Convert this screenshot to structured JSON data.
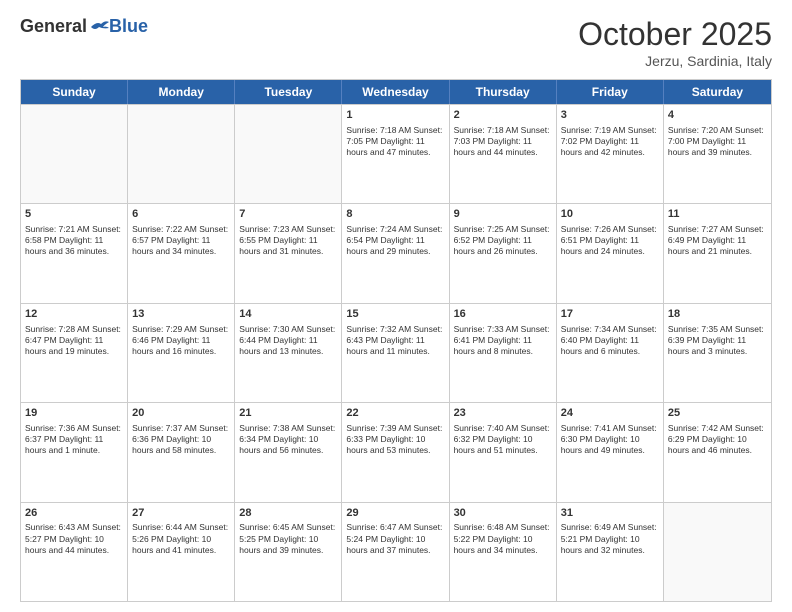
{
  "logo": {
    "general": "General",
    "blue": "Blue"
  },
  "title": "October 2025",
  "location": "Jerzu, Sardinia, Italy",
  "days_of_week": [
    "Sunday",
    "Monday",
    "Tuesday",
    "Wednesday",
    "Thursday",
    "Friday",
    "Saturday"
  ],
  "weeks": [
    [
      {
        "day": "",
        "info": ""
      },
      {
        "day": "",
        "info": ""
      },
      {
        "day": "",
        "info": ""
      },
      {
        "day": "1",
        "info": "Sunrise: 7:18 AM\nSunset: 7:05 PM\nDaylight: 11 hours and 47 minutes."
      },
      {
        "day": "2",
        "info": "Sunrise: 7:18 AM\nSunset: 7:03 PM\nDaylight: 11 hours and 44 minutes."
      },
      {
        "day": "3",
        "info": "Sunrise: 7:19 AM\nSunset: 7:02 PM\nDaylight: 11 hours and 42 minutes."
      },
      {
        "day": "4",
        "info": "Sunrise: 7:20 AM\nSunset: 7:00 PM\nDaylight: 11 hours and 39 minutes."
      }
    ],
    [
      {
        "day": "5",
        "info": "Sunrise: 7:21 AM\nSunset: 6:58 PM\nDaylight: 11 hours and 36 minutes."
      },
      {
        "day": "6",
        "info": "Sunrise: 7:22 AM\nSunset: 6:57 PM\nDaylight: 11 hours and 34 minutes."
      },
      {
        "day": "7",
        "info": "Sunrise: 7:23 AM\nSunset: 6:55 PM\nDaylight: 11 hours and 31 minutes."
      },
      {
        "day": "8",
        "info": "Sunrise: 7:24 AM\nSunset: 6:54 PM\nDaylight: 11 hours and 29 minutes."
      },
      {
        "day": "9",
        "info": "Sunrise: 7:25 AM\nSunset: 6:52 PM\nDaylight: 11 hours and 26 minutes."
      },
      {
        "day": "10",
        "info": "Sunrise: 7:26 AM\nSunset: 6:51 PM\nDaylight: 11 hours and 24 minutes."
      },
      {
        "day": "11",
        "info": "Sunrise: 7:27 AM\nSunset: 6:49 PM\nDaylight: 11 hours and 21 minutes."
      }
    ],
    [
      {
        "day": "12",
        "info": "Sunrise: 7:28 AM\nSunset: 6:47 PM\nDaylight: 11 hours and 19 minutes."
      },
      {
        "day": "13",
        "info": "Sunrise: 7:29 AM\nSunset: 6:46 PM\nDaylight: 11 hours and 16 minutes."
      },
      {
        "day": "14",
        "info": "Sunrise: 7:30 AM\nSunset: 6:44 PM\nDaylight: 11 hours and 13 minutes."
      },
      {
        "day": "15",
        "info": "Sunrise: 7:32 AM\nSunset: 6:43 PM\nDaylight: 11 hours and 11 minutes."
      },
      {
        "day": "16",
        "info": "Sunrise: 7:33 AM\nSunset: 6:41 PM\nDaylight: 11 hours and 8 minutes."
      },
      {
        "day": "17",
        "info": "Sunrise: 7:34 AM\nSunset: 6:40 PM\nDaylight: 11 hours and 6 minutes."
      },
      {
        "day": "18",
        "info": "Sunrise: 7:35 AM\nSunset: 6:39 PM\nDaylight: 11 hours and 3 minutes."
      }
    ],
    [
      {
        "day": "19",
        "info": "Sunrise: 7:36 AM\nSunset: 6:37 PM\nDaylight: 11 hours and 1 minute."
      },
      {
        "day": "20",
        "info": "Sunrise: 7:37 AM\nSunset: 6:36 PM\nDaylight: 10 hours and 58 minutes."
      },
      {
        "day": "21",
        "info": "Sunrise: 7:38 AM\nSunset: 6:34 PM\nDaylight: 10 hours and 56 minutes."
      },
      {
        "day": "22",
        "info": "Sunrise: 7:39 AM\nSunset: 6:33 PM\nDaylight: 10 hours and 53 minutes."
      },
      {
        "day": "23",
        "info": "Sunrise: 7:40 AM\nSunset: 6:32 PM\nDaylight: 10 hours and 51 minutes."
      },
      {
        "day": "24",
        "info": "Sunrise: 7:41 AM\nSunset: 6:30 PM\nDaylight: 10 hours and 49 minutes."
      },
      {
        "day": "25",
        "info": "Sunrise: 7:42 AM\nSunset: 6:29 PM\nDaylight: 10 hours and 46 minutes."
      }
    ],
    [
      {
        "day": "26",
        "info": "Sunrise: 6:43 AM\nSunset: 5:27 PM\nDaylight: 10 hours and 44 minutes."
      },
      {
        "day": "27",
        "info": "Sunrise: 6:44 AM\nSunset: 5:26 PM\nDaylight: 10 hours and 41 minutes."
      },
      {
        "day": "28",
        "info": "Sunrise: 6:45 AM\nSunset: 5:25 PM\nDaylight: 10 hours and 39 minutes."
      },
      {
        "day": "29",
        "info": "Sunrise: 6:47 AM\nSunset: 5:24 PM\nDaylight: 10 hours and 37 minutes."
      },
      {
        "day": "30",
        "info": "Sunrise: 6:48 AM\nSunset: 5:22 PM\nDaylight: 10 hours and 34 minutes."
      },
      {
        "day": "31",
        "info": "Sunrise: 6:49 AM\nSunset: 5:21 PM\nDaylight: 10 hours and 32 minutes."
      },
      {
        "day": "",
        "info": ""
      }
    ]
  ]
}
